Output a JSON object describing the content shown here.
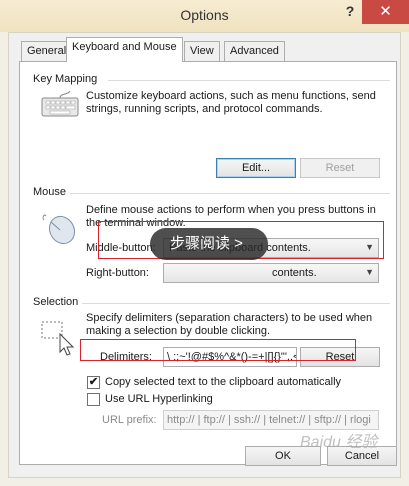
{
  "window": {
    "title": "Options",
    "help": "?",
    "close": "✕"
  },
  "tabs": [
    "General",
    "Keyboard and Mouse",
    "View",
    "Advanced"
  ],
  "key_mapping": {
    "title": "Key Mapping",
    "desc1": "Customize keyboard actions, such as menu functions, send",
    "desc2": "strings, running scripts,  and protocol commands.",
    "edit": "Edit...",
    "reset": "Reset"
  },
  "mouse": {
    "title": "Mouse",
    "desc1": "Define mouse actions to perform when you press buttons in",
    "desc2": "the terminal window.",
    "middle_label": "Middle-button:",
    "middle_value": "Paste the clipboard contents.",
    "right_label": "Right-button:",
    "right_value": "contents."
  },
  "selection": {
    "title": "Selection",
    "desc1": "Specify delimiters (separation characters) to be used when",
    "desc2": "making a selection by double clicking.",
    "delimiters_label": "Delimiters:",
    "delimiters_value": "\\ :;~'!@#$%^&*()-=+|[]{}\"',.<",
    "reset": "Reset",
    "copy_label": "Copy selected text to the clipboard automatically",
    "copy_checked": "✔",
    "url_label": "Use URL Hyperlinking",
    "url_prefix_label": "URL prefix:",
    "url_prefix_value": "http:// | ftp:// | ssh:// | telnet:// | sftp:// | rlogi"
  },
  "overlay_text": "步骤阅读  >",
  "watermark": "Baidu 经验",
  "buttons": {
    "ok": "OK",
    "cancel": "Cancel"
  }
}
